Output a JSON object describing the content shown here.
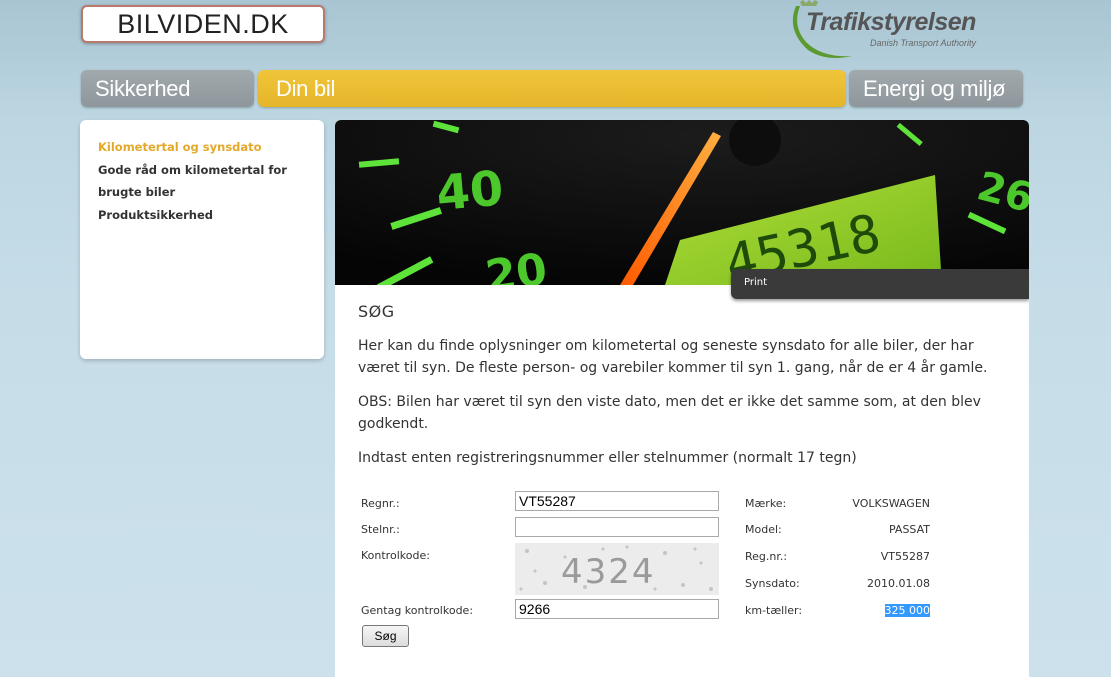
{
  "header": {
    "site_logo": "BILVIDEN.DK",
    "authority_name": "Trafikstyrelsen",
    "authority_subtitle": "Danish Transport Authority"
  },
  "nav": {
    "tabs": [
      {
        "label": "Sikkerhed",
        "active": false
      },
      {
        "label": "Din bil",
        "active": true
      },
      {
        "label": "Energi og miljø",
        "active": false
      }
    ]
  },
  "sidebar": {
    "items": [
      {
        "label": "Kilometertal og synsdato",
        "active": true
      },
      {
        "label": "Gode råd om kilometertal for brugte biler",
        "active": false
      },
      {
        "label": "Produktsikkerhed",
        "active": false
      }
    ]
  },
  "banner": {
    "print_label": "Print"
  },
  "main": {
    "heading": "SØG",
    "intro": "Her kan du finde oplysninger om kilometertal og seneste synsdato for alle biler, der har været til syn. De fleste person- og varebiler kommer til syn 1. gang, når de er 4 år gamle.",
    "obs": "OBS: Bilen har været til syn den viste dato, men det er ikke det samme som, at den blev godkendt.",
    "instruction": "Indtast enten registreringsnummer eller stelnummer (normalt 17 tegn)"
  },
  "form": {
    "regnr_label": "Regnr.:",
    "regnr_value": "VT55287",
    "stelnr_label": "Stelnr.:",
    "stelnr_value": "",
    "kontrolkode_label": "Kontrolkode:",
    "captcha_text": "4324",
    "gentag_label": "Gentag kontrolkode:",
    "gentag_value": "9266",
    "submit_label": "Søg"
  },
  "result": {
    "rows": [
      {
        "label": "Mærke:",
        "value": "VOLKSWAGEN"
      },
      {
        "label": "Model:",
        "value": "PASSAT"
      },
      {
        "label": "Reg.nr.:",
        "value": "VT55287"
      },
      {
        "label": "Synsdato:",
        "value": "2010.01.08"
      },
      {
        "label": "km-tæller:",
        "value": "325 000"
      }
    ]
  },
  "colors": {
    "accent_yellow": "#e8b830",
    "tab_grey": "#979ea2",
    "active_link": "#e2a92a",
    "selection": "#3399ff"
  }
}
